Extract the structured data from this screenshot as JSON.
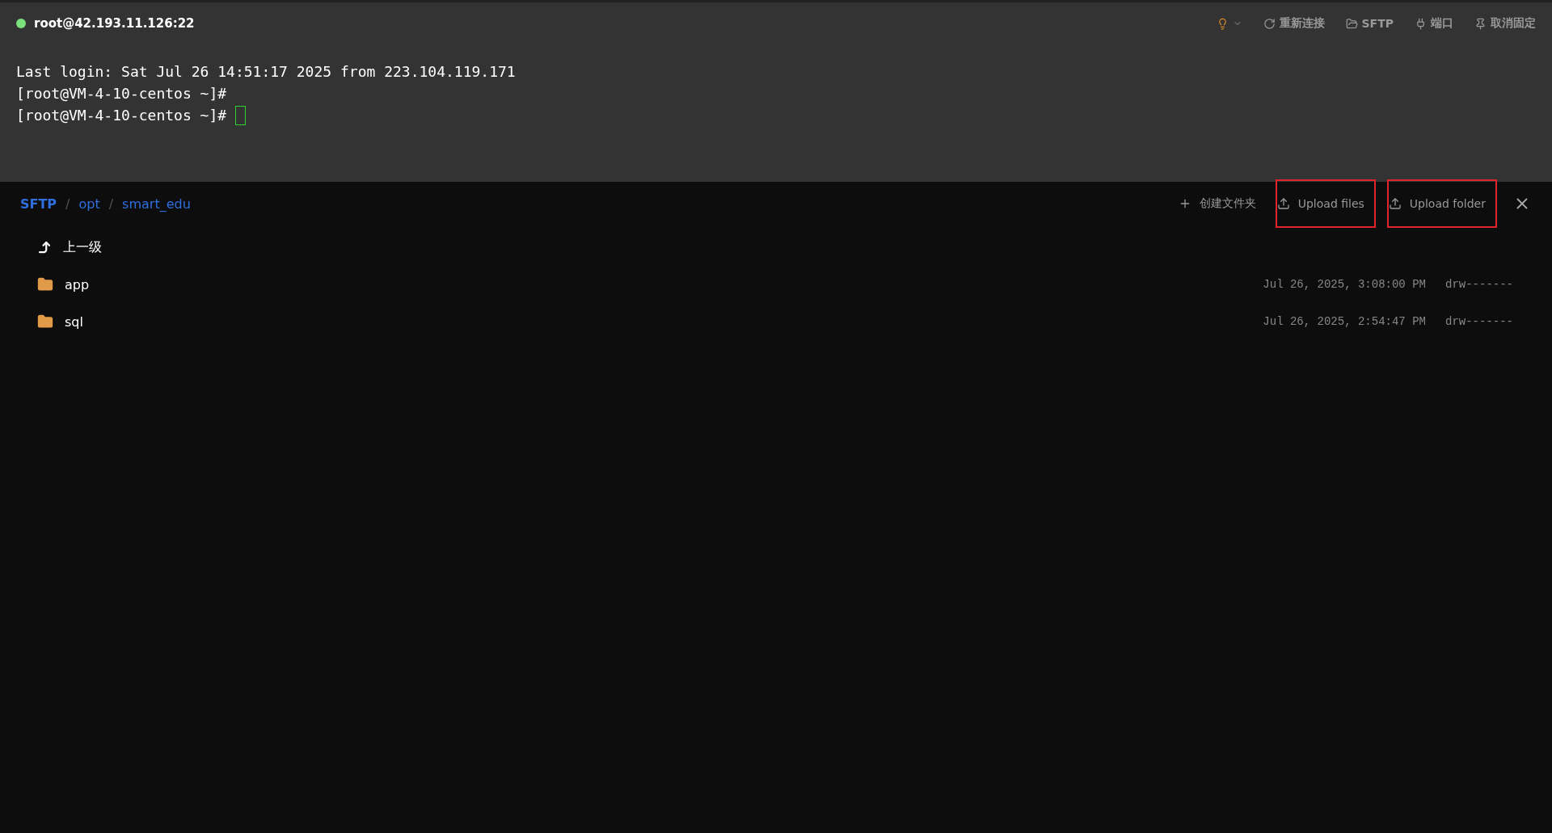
{
  "session": {
    "title": "root@42.193.11.126:22",
    "connected": true
  },
  "toolbar": [
    {
      "kind": "bulb"
    },
    {
      "kind": "reconnect",
      "label": "重新连接"
    },
    {
      "kind": "sftp",
      "label": "SFTP"
    },
    {
      "kind": "port",
      "label": "端口"
    },
    {
      "kind": "pin",
      "label": "取消固定"
    }
  ],
  "terminal": {
    "lines": [
      "Last login: Sat Jul 26 14:51:17 2025 from 223.104.119.171",
      "[root@VM-4-10-centos ~]#",
      "[root@VM-4-10-centos ~]# "
    ]
  },
  "sftp": {
    "breadcrumb": [
      "SFTP",
      "opt",
      "smart_edu"
    ],
    "breadcrumb_separator": "/",
    "actions": [
      {
        "kind": "create",
        "label": "创建文件夹",
        "highlighted": false
      },
      {
        "kind": "upload",
        "label": "Upload files",
        "highlighted": true
      },
      {
        "kind": "upload",
        "label": "Upload folder",
        "highlighted": true
      }
    ],
    "parent": "上一级",
    "files": [
      {
        "name": "app",
        "modified": "Jul 26, 2025, 3:08:00 PM",
        "permissions": "drw-------"
      },
      {
        "name": "sql",
        "modified": "Jul 26, 2025, 2:54:47 PM",
        "permissions": "drw-------"
      }
    ]
  }
}
